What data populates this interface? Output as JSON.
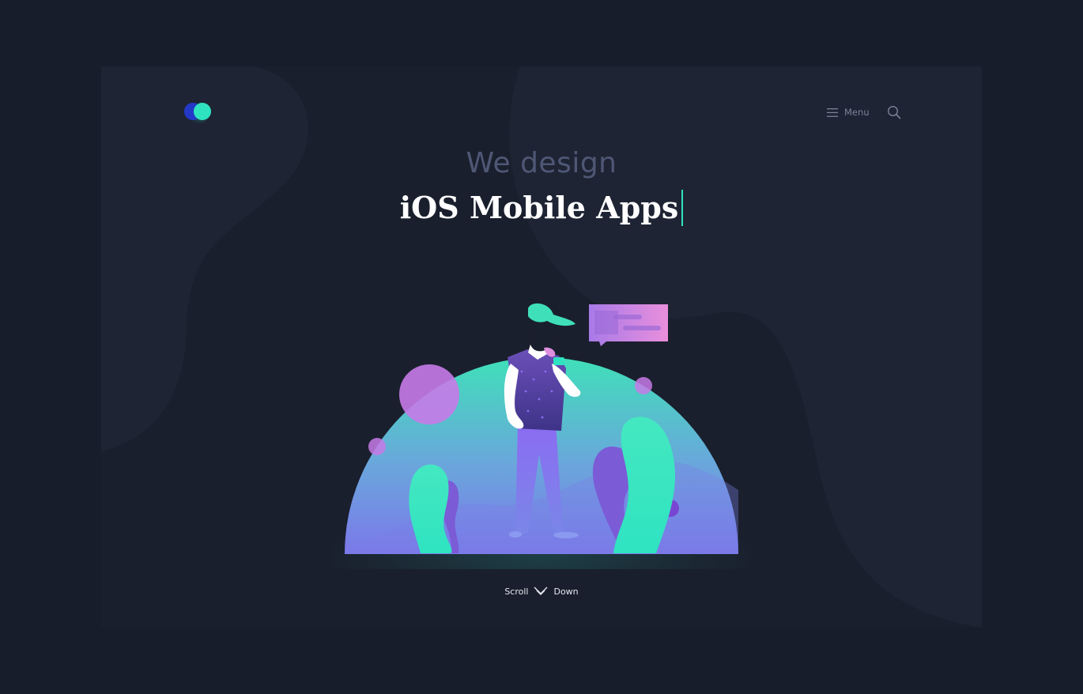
{
  "header": {
    "menu_label": "Menu",
    "logo_icon": "two-overlapping-dots-logo",
    "menu_icon": "hamburger-icon",
    "search_icon": "search-icon"
  },
  "hero": {
    "eyebrow": "We design",
    "headline": "iOS Mobile Apps"
  },
  "scroll": {
    "left_word": "Scroll",
    "right_word": "Down",
    "icon": "double-chevron-down-icon"
  },
  "colors": {
    "background": "#181d2b",
    "accent_teal": "#2fe3c1",
    "accent_purple": "#8b6cf2",
    "accent_pink": "#e08ee0",
    "muted_text": "#4f5775"
  }
}
